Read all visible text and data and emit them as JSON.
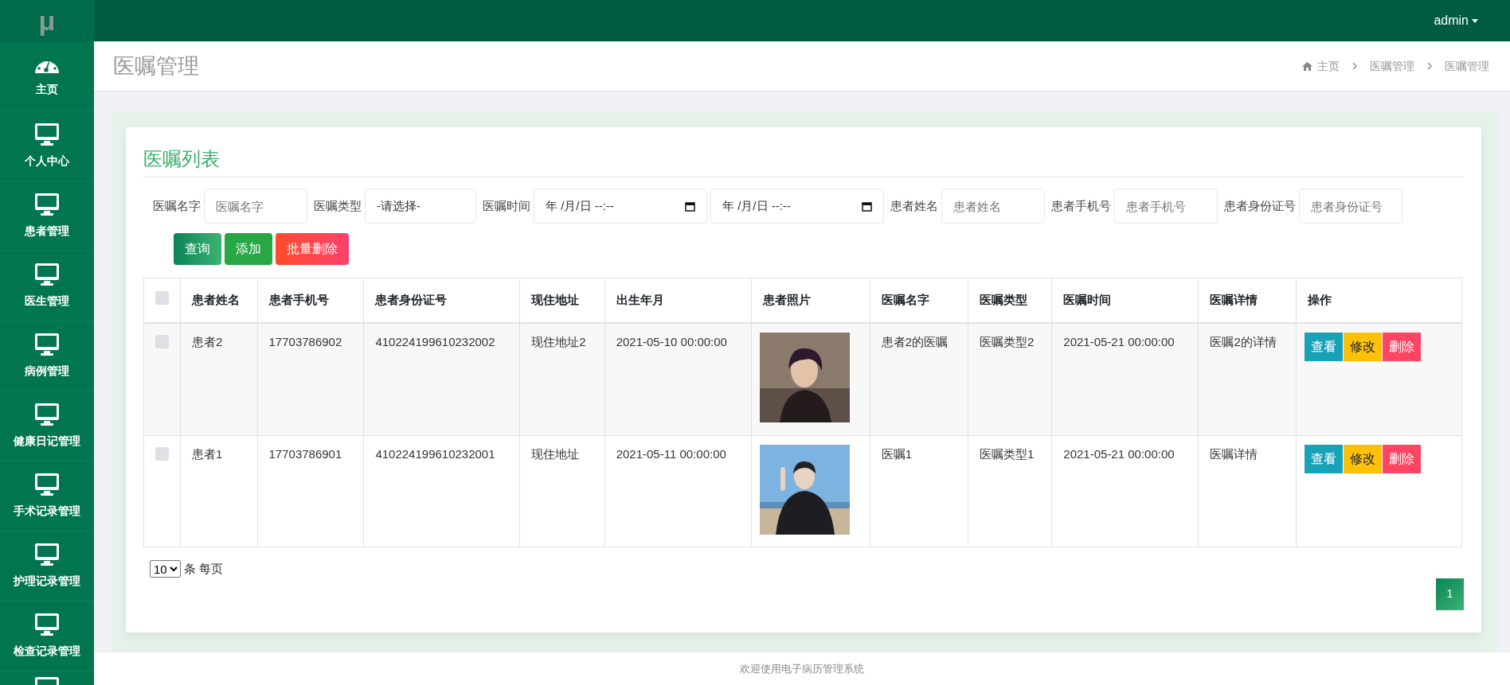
{
  "logo": {
    "text": "μ"
  },
  "top_bar": {
    "user": "admin"
  },
  "sidebar": {
    "items": [
      {
        "label": "主页",
        "kind": "gauge",
        "selected": false
      },
      {
        "label": "个人中心",
        "kind": "monitor",
        "selected": false
      },
      {
        "label": "患者管理",
        "kind": "monitor",
        "selected": false
      },
      {
        "label": "医生管理",
        "kind": "monitor",
        "selected": false
      },
      {
        "label": "病例管理",
        "kind": "monitor",
        "selected": false
      },
      {
        "label": "健康日记管理",
        "kind": "monitor",
        "selected": false
      },
      {
        "label": "手术记录管理",
        "kind": "monitor",
        "selected": false
      },
      {
        "label": "护理记录管理",
        "kind": "monitor",
        "selected": false
      },
      {
        "label": "检查记录管理",
        "kind": "monitor",
        "selected": false
      },
      {
        "kind": "monitor",
        "selected": false
      }
    ]
  },
  "page_title": "医嘱管理",
  "breadcrumb": [
    "主页",
    "医嘱管理",
    "医嘱管理"
  ],
  "card_title": "医嘱列表",
  "filters": [
    {
      "kind": "text",
      "label": "医嘱名字",
      "placeholder": "医嘱名字"
    },
    {
      "kind": "select",
      "label": "医嘱类型",
      "value": "-请选择-"
    },
    {
      "kind": "date",
      "label": "医嘱时间",
      "value": "年 /月/日 --:--"
    },
    {
      "kind": "date",
      "value": "年 /月/日 --:--"
    },
    {
      "kind": "text",
      "label": "患者姓名",
      "placeholder": "患者姓名"
    },
    {
      "kind": "text",
      "label": "患者手机号",
      "placeholder": "患者手机号"
    },
    {
      "kind": "text",
      "label": "患者身份证号",
      "placeholder": "患者身份证号"
    }
  ],
  "buttons": [
    {
      "label": "查询",
      "kind": "search"
    },
    {
      "label": "添加",
      "kind": "add"
    },
    {
      "label": "批量删除",
      "kind": "delete"
    }
  ],
  "table": {
    "header_checked": false,
    "columns": [
      "患者姓名",
      "患者手机号",
      "患者身份证号",
      "现住地址",
      "出生年月",
      "患者照片",
      "医嘱名字",
      "医嘱类型",
      "医嘱时间",
      "医嘱详情",
      "操作"
    ],
    "rows": [
      {
        "checked": false,
        "cells": [
          "患者2",
          "17703786902",
          "410224199610232002",
          "现住地址2",
          "2021-05-10 00:00:00",
          {
            "kind": "picture"
          },
          "患者2的医嘱",
          "医嘱类型2",
          "2021-05-21 00:00:00",
          "医嘱2的详情"
        ],
        "actions": [
          {
            "label": "查看",
            "kind": "view"
          },
          {
            "label": "修改",
            "kind": "edit"
          },
          {
            "label": "删除",
            "kind": "delete"
          }
        ]
      },
      {
        "checked": false,
        "cells": [
          "患者1",
          "17703786901",
          "410224199610232001",
          "现住地址",
          "2021-05-11 00:00:00",
          {
            "kind": "picture"
          },
          "医嘱1",
          "医嘱类型1",
          "2021-05-21 00:00:00",
          "医嘱详情"
        ],
        "actions": [
          {
            "label": "查看",
            "kind": "view"
          },
          {
            "label": "修改",
            "kind": "edit"
          },
          {
            "label": "删除",
            "kind": "delete"
          }
        ]
      }
    ]
  },
  "page_size": {
    "value": "10",
    "label": "条 每页"
  },
  "pagination": [
    {
      "label": "1",
      "selected": true
    }
  ],
  "footer": "欢迎使用电子病历管理系统"
}
